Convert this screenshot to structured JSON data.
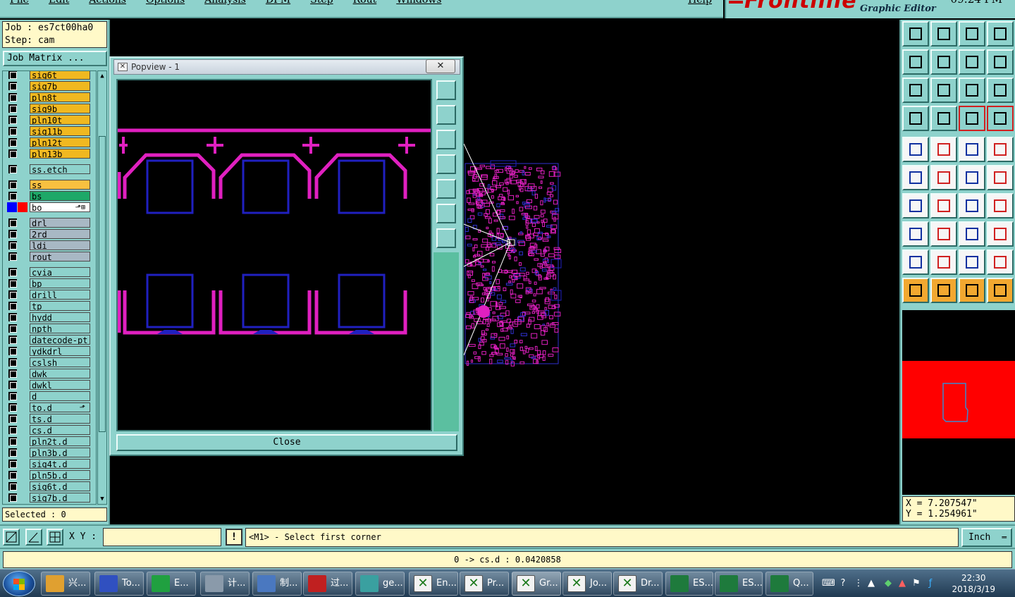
{
  "menu": {
    "items": [
      "File",
      "Edit",
      "Actions",
      "Options",
      "Analysis",
      "DFM",
      "Step",
      "Rout",
      "Windows"
    ],
    "help": "Help"
  },
  "brand": {
    "logo": "Frontline",
    "subtitle": "Graphic Editor",
    "time": "09:24 PM"
  },
  "job": {
    "job_line": "Job : es7ct00ha0",
    "step_line": "Step: cam",
    "matrix_button": "Job Matrix ..."
  },
  "layers": [
    {
      "name": "sig6t",
      "type": "sig"
    },
    {
      "name": "sig7b",
      "type": "sig"
    },
    {
      "name": "pln8t",
      "type": "sig"
    },
    {
      "name": "sig9b",
      "type": "sig"
    },
    {
      "name": "pln10t",
      "type": "sig"
    },
    {
      "name": "sig11b",
      "type": "sig"
    },
    {
      "name": "pln12t",
      "type": "sig"
    },
    {
      "name": "pln13b",
      "type": "sig"
    },
    {
      "name": "ss.etch",
      "type": "doc"
    },
    {
      "name": "ss",
      "type": "silk"
    },
    {
      "name": "bs",
      "type": "mask"
    },
    {
      "name": "bo",
      "type": "bo"
    },
    {
      "name": "drl",
      "type": "drl"
    },
    {
      "name": "2rd",
      "type": "drl"
    },
    {
      "name": "ldi",
      "type": "drl"
    },
    {
      "name": "rout",
      "type": "drl"
    },
    {
      "name": "cvia",
      "type": "doc"
    },
    {
      "name": "bp",
      "type": "doc"
    },
    {
      "name": "drill",
      "type": "doc"
    },
    {
      "name": "tp",
      "type": "doc"
    },
    {
      "name": "hydd",
      "type": "doc"
    },
    {
      "name": "npth",
      "type": "doc"
    },
    {
      "name": "datecode-pt",
      "type": "doc"
    },
    {
      "name": "ydkdrl",
      "type": "doc"
    },
    {
      "name": "cslsh",
      "type": "doc"
    },
    {
      "name": "dwk",
      "type": "doc"
    },
    {
      "name": "dwkl",
      "type": "doc"
    },
    {
      "name": "d",
      "type": "doc"
    },
    {
      "name": "to.d",
      "type": "doc"
    },
    {
      "name": "ts.d",
      "type": "doc"
    },
    {
      "name": "cs.d",
      "type": "doc"
    },
    {
      "name": "pln2t.d",
      "type": "doc"
    },
    {
      "name": "pln3b.d",
      "type": "doc"
    },
    {
      "name": "sig4t.d",
      "type": "doc"
    },
    {
      "name": "pln5b.d",
      "type": "doc"
    },
    {
      "name": "sig6t.d",
      "type": "doc"
    },
    {
      "name": "sig7b.d",
      "type": "doc"
    }
  ],
  "selected": "Selected : 0",
  "popview": {
    "title": "Popview - 1",
    "close_x": "✕",
    "close_button": "Close"
  },
  "coords": {
    "x": "X = 7.207547\"",
    "y": "Y = 1.254961\""
  },
  "command": {
    "xy_label": "X Y :",
    "xy_value": "",
    "bang": "!",
    "prompt": "<M1> - Select first corner",
    "units": "Inch"
  },
  "status": "0 -> cs.d : 0.0420858",
  "taskbar": {
    "tasks": [
      {
        "label": "兴...",
        "icon": "shell-icon"
      },
      {
        "label": "To...",
        "icon": "floppy-icon"
      },
      {
        "label": "E...",
        "icon": "frontline-icon"
      },
      {
        "label": "计...",
        "icon": "calculator-icon"
      },
      {
        "label": "制...",
        "icon": "notepad-icon"
      },
      {
        "label": "过...",
        "icon": "pdf-icon"
      },
      {
        "label": "ge...",
        "icon": "camera-icon"
      },
      {
        "label": "En...",
        "icon": "genesis-icon"
      },
      {
        "label": "Pr...",
        "icon": "genesis-icon"
      },
      {
        "label": "Gr...",
        "icon": "genesis-icon"
      },
      {
        "label": "Jo...",
        "icon": "genesis-icon"
      },
      {
        "label": "Dr...",
        "icon": "genesis-icon"
      },
      {
        "label": "ES...",
        "icon": "excel-icon"
      },
      {
        "label": "ES...",
        "icon": "excel-icon"
      },
      {
        "label": "Q...",
        "icon": "excel-icon"
      }
    ],
    "clock_time": "22:30",
    "clock_date": "2018/3/19"
  },
  "colors": {
    "panel": "#8ed2cc",
    "trace": "#e020c0",
    "pad": "#2020c0",
    "yellow": "#fff9c8"
  }
}
